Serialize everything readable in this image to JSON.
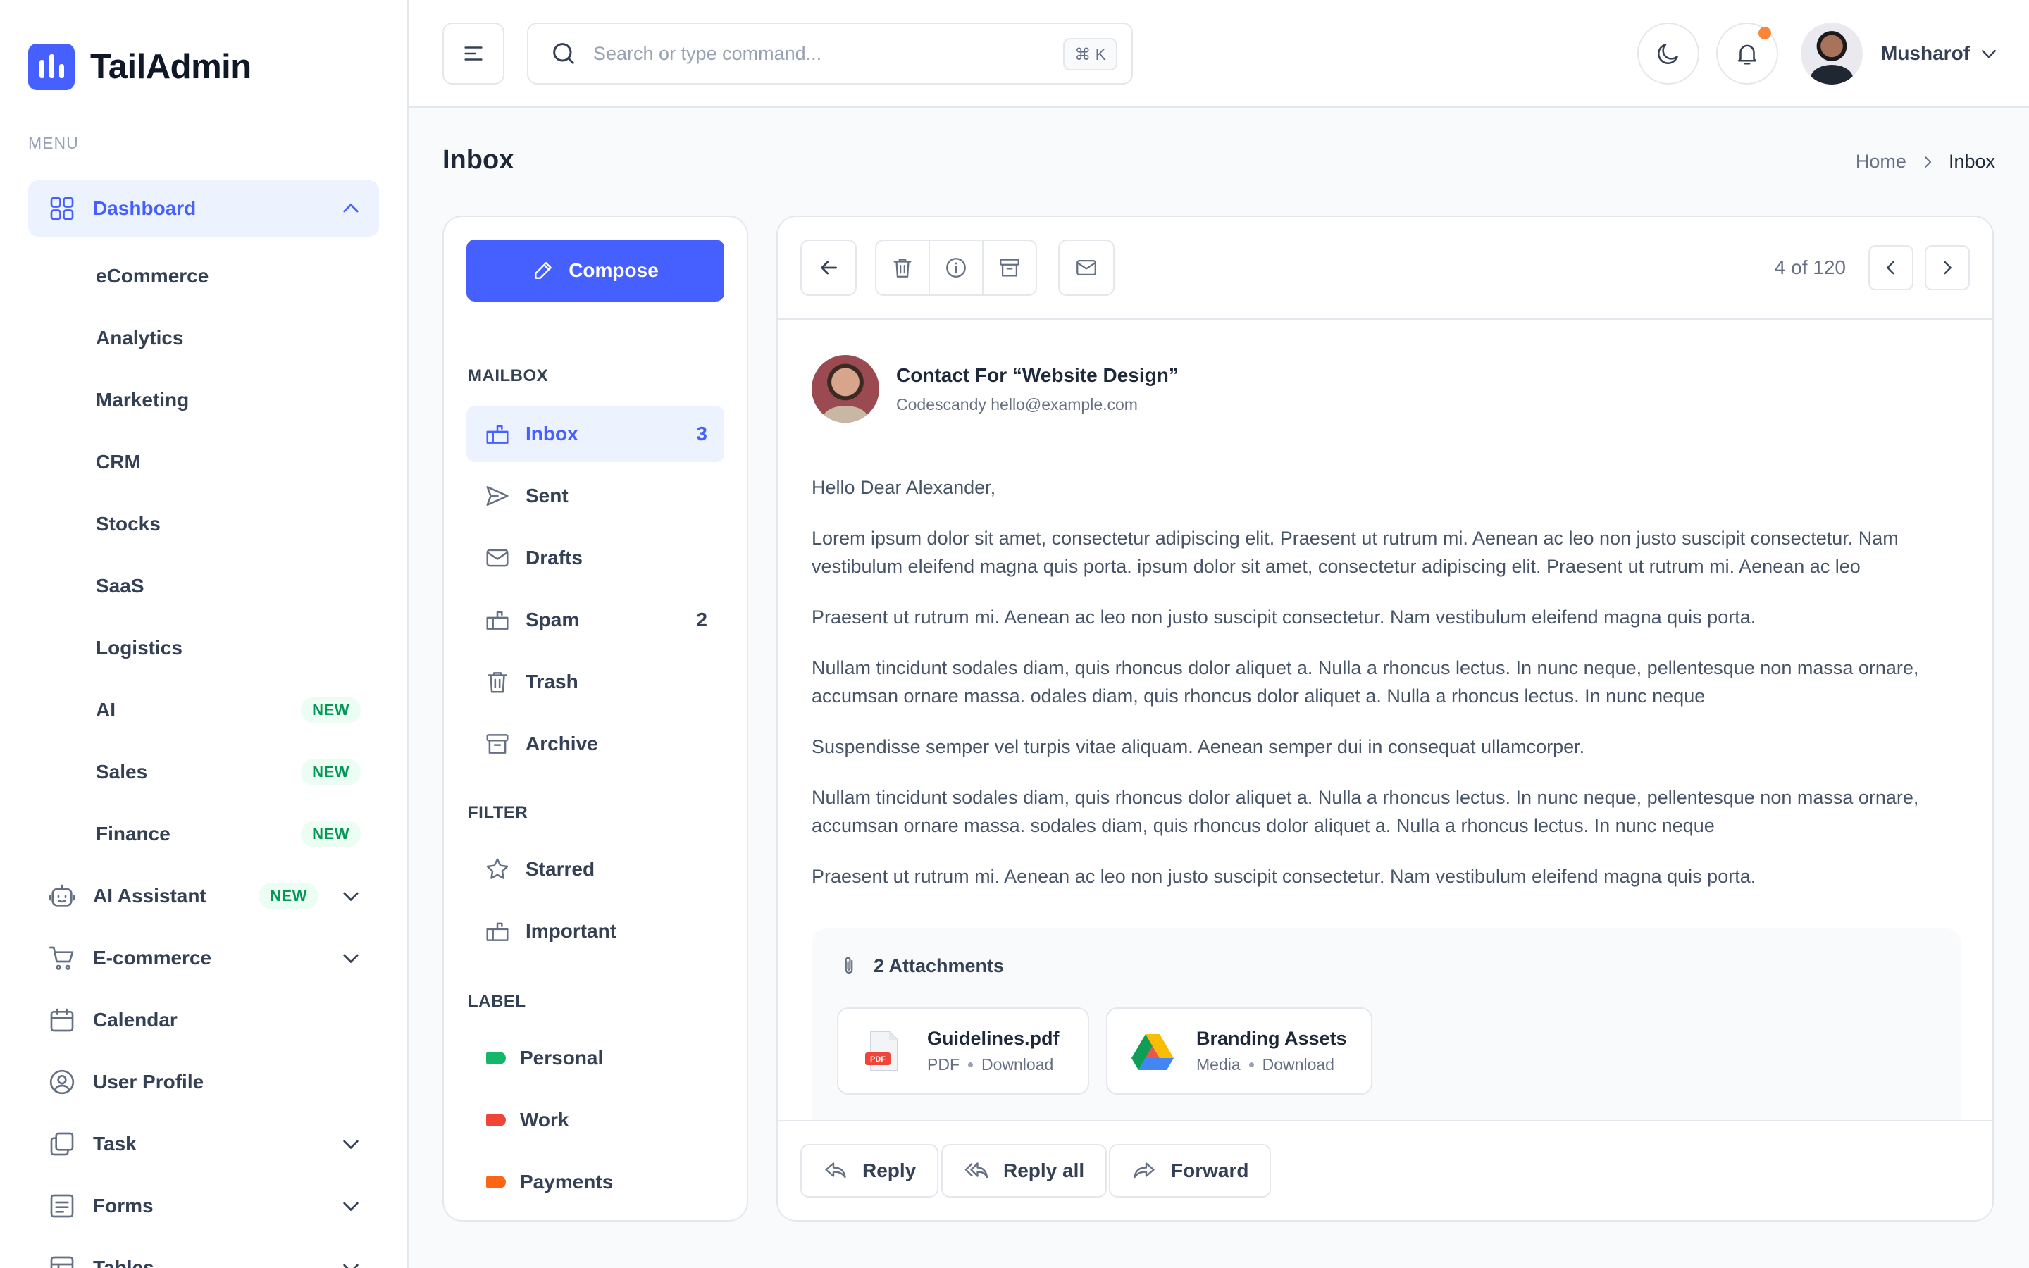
{
  "brand": {
    "name": "TailAdmin"
  },
  "sidebar": {
    "menu_title": "MENU",
    "dashboard": {
      "label": "Dashboard",
      "icon": "grid-icon"
    },
    "dashboard_items": [
      {
        "label": "eCommerce"
      },
      {
        "label": "Analytics"
      },
      {
        "label": "Marketing"
      },
      {
        "label": "CRM"
      },
      {
        "label": "Stocks"
      },
      {
        "label": "SaaS"
      },
      {
        "label": "Logistics"
      },
      {
        "label": "AI",
        "badge": "NEW"
      },
      {
        "label": "Sales",
        "badge": "NEW"
      },
      {
        "label": "Finance",
        "badge": "NEW"
      }
    ],
    "items": [
      {
        "label": "AI Assistant",
        "badge": "NEW",
        "icon": "robot-icon"
      },
      {
        "label": "E-commerce",
        "icon": "cart-icon"
      },
      {
        "label": "Calendar",
        "icon": "calendar-icon"
      },
      {
        "label": "User Profile",
        "icon": "user-circle-icon"
      },
      {
        "label": "Task",
        "icon": "task-icon"
      },
      {
        "label": "Forms",
        "icon": "form-icon"
      },
      {
        "label": "Tables",
        "icon": "table-icon"
      }
    ]
  },
  "header": {
    "search_placeholder": "Search or type command...",
    "search_shortcut": "⌘ K",
    "user_name": "Musharof"
  },
  "page": {
    "title": "Inbox",
    "breadcrumb": {
      "home": "Home",
      "current": "Inbox"
    }
  },
  "mailbox": {
    "compose_label": "Compose",
    "mailbox_title": "MAILBOX",
    "folders": [
      {
        "label": "Inbox",
        "count": "3",
        "icon": "inbox-icon"
      },
      {
        "label": "Sent",
        "count": "",
        "icon": "send-icon"
      },
      {
        "label": "Drafts",
        "count": "",
        "icon": "mail-icon"
      },
      {
        "label": "Spam",
        "count": "2",
        "icon": "spam-icon"
      },
      {
        "label": "Trash",
        "count": "",
        "icon": "trash-icon"
      },
      {
        "label": "Archive",
        "count": "",
        "icon": "archive-icon"
      }
    ],
    "filter_title": "FILTER",
    "filters": [
      {
        "label": "Starred",
        "icon": "star-icon"
      },
      {
        "label": "Important",
        "icon": "important-icon"
      }
    ],
    "label_title": "LABEL",
    "labels": [
      {
        "label": "Personal",
        "color": "#12b76a"
      },
      {
        "label": "Work",
        "color": "#f04438"
      },
      {
        "label": "Payments",
        "color": "#fb6514"
      }
    ]
  },
  "email": {
    "pager": "4 of 120",
    "subject": "Contact For “Website Design”",
    "from": "Codescandy hello@example.com",
    "greeting": "Hello Dear Alexander,",
    "paragraphs": [
      "Lorem ipsum dolor sit amet, consectetur adipiscing elit. Praesent ut rutrum mi. Aenean ac leo non justo suscipit consectetur. Nam vestibulum eleifend magna quis porta. ipsum dolor sit amet, consectetur adipiscing elit. Praesent ut rutrum mi. Aenean ac leo",
      "Praesent ut rutrum mi. Aenean ac leo non justo suscipit consectetur. Nam vestibulum eleifend magna quis porta.",
      "Nullam tincidunt sodales diam, quis rhoncus dolor aliquet a. Nulla a rhoncus lectus. In nunc neque, pellentesque non massa ornare, accumsan ornare massa. odales diam, quis rhoncus dolor aliquet a. Nulla a rhoncus lectus. In nunc neque",
      "Suspendisse semper vel turpis vitae aliquam. Aenean semper dui in consequat ullamcorper.",
      "Nullam tincidunt sodales diam, quis rhoncus dolor aliquet a. Nulla a rhoncus lectus. In nunc neque, pellentesque non massa ornare, accumsan ornare massa. sodales diam, quis rhoncus dolor aliquet a. Nulla a rhoncus lectus. In nunc neque",
      "Praesent ut rutrum mi. Aenean ac leo non justo suscipit consectetur. Nam vestibulum eleifend magna quis porta."
    ],
    "attachments_title": "2 Attachments",
    "attachments": [
      {
        "name": "Guidelines.pdf",
        "type": "PDF",
        "action": "Download",
        "icon": "pdf-icon"
      },
      {
        "name": "Branding Assets",
        "type": "Media",
        "action": "Download",
        "icon": "google-drive-icon"
      }
    ],
    "actions": {
      "reply": "Reply",
      "reply_all": "Reply all",
      "forward": "Forward"
    }
  },
  "colors": {
    "accent": "#465fff",
    "badge_green": "#039855",
    "notification": "#fd853a"
  }
}
